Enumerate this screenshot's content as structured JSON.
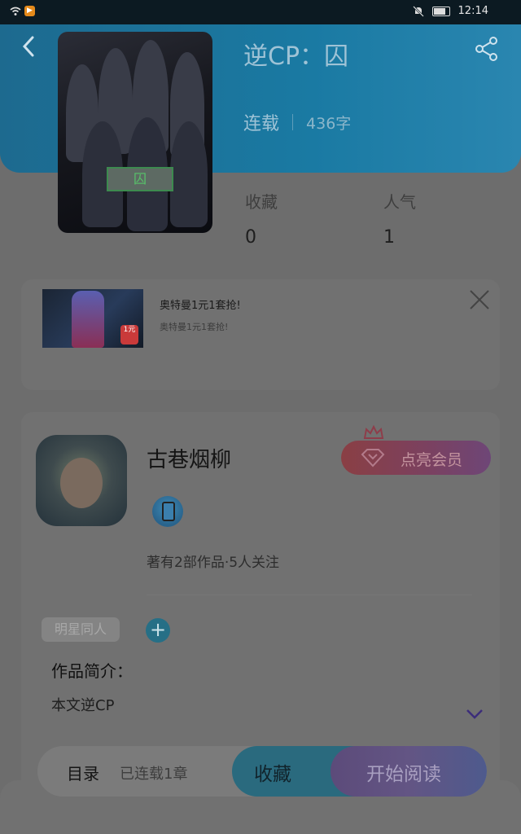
{
  "status_bar": {
    "time": "12:14",
    "app_badge": "▶"
  },
  "book": {
    "title": "逆CP：囚",
    "status": "连载",
    "word_count": "436字",
    "cover_label": "囚",
    "favorites_label": "收藏",
    "favorites_value": "0",
    "popularity_label": "人气",
    "popularity_value": "1"
  },
  "ad": {
    "title": "奥特曼1元1套抢!",
    "subtitle": "奥特曼1元1套抢!",
    "price_tag": "1元"
  },
  "author": {
    "name": "古巷烟柳",
    "vip_button": "点亮会员",
    "works_info": "著有2部作品·5人关注",
    "tag": "明星同人",
    "add_tag": "+",
    "intro_heading": "作品简介：",
    "intro_text": "本文逆CP"
  },
  "bottom_bar": {
    "toc": "目录",
    "chapters": "已连载1章",
    "favorite_button": "收藏",
    "read_button": "开始阅读"
  },
  "colors": {
    "hero": "#1a7aa3",
    "fav": "#2a6a7e",
    "read": "#635584"
  }
}
